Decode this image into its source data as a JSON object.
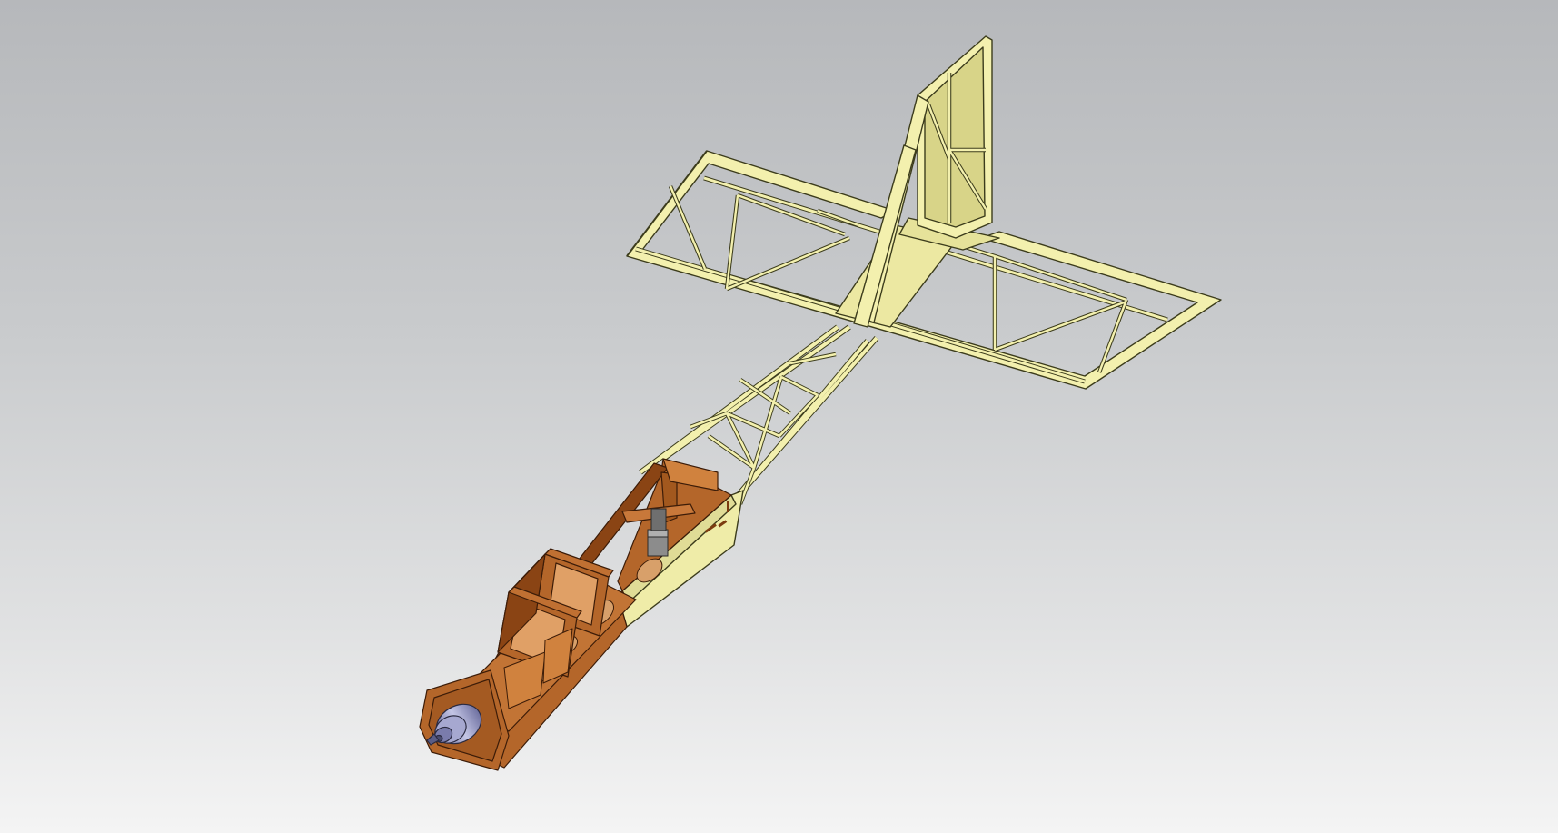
{
  "scene": {
    "subject": "rc-airplane-fuselage-and-tail-truss",
    "background_top": "#b6b8bb",
    "background_bottom": "#f4f4f4"
  },
  "colors": {
    "truss_fill": "#f3f0ae",
    "truss_stroke": "#3c3c1c",
    "truss_shade": "#d8d488",
    "plywood_fill": "#b4662a",
    "plywood_dark": "#7c3c10",
    "plywood_light": "#d0823e",
    "motor_body": "#9a9cc4",
    "motor_dark": "#5a5c84",
    "servo_gray": "#8c8c8c"
  },
  "icons": [
    "motor-icon",
    "servo-icon"
  ]
}
